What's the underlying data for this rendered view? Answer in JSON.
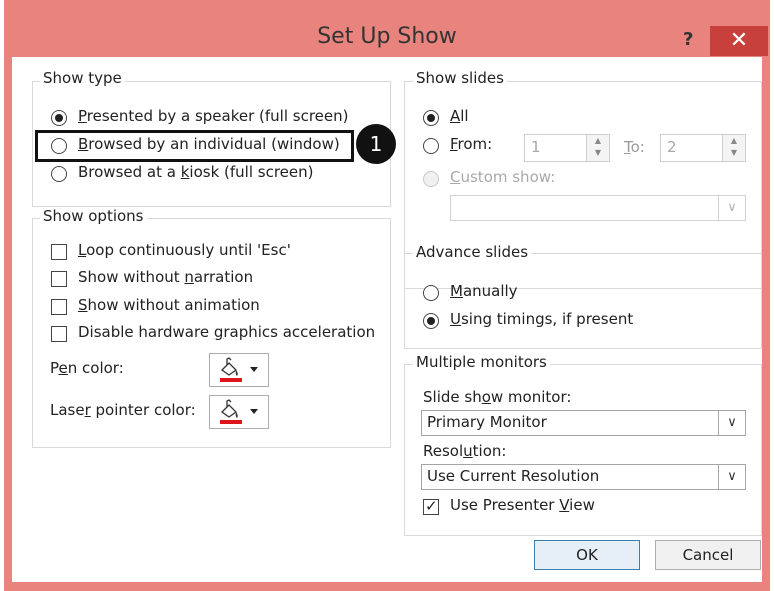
{
  "dialog": {
    "title": "Set Up Show",
    "help_glyph": "?",
    "close_glyph": "✕"
  },
  "show_type": {
    "legend": "Show type",
    "options": [
      {
        "pre": "",
        "ul": "P",
        "post": "resented by a speaker (full screen)",
        "selected": true
      },
      {
        "pre": "",
        "ul": "B",
        "post": "rowsed by an individual (window)",
        "selected": false
      },
      {
        "pre": "Browsed at a ",
        "ul": "k",
        "post": "iosk (full screen)",
        "selected": false
      }
    ]
  },
  "show_options": {
    "legend": "Show options",
    "checks": [
      {
        "pre": "",
        "ul": "L",
        "post": "oop continuously until 'Esc'",
        "checked": false
      },
      {
        "pre": "Show without ",
        "ul": "n",
        "post": "arration",
        "checked": false
      },
      {
        "pre": "",
        "ul": "S",
        "post": "how without animation",
        "checked": false
      },
      {
        "pre": "Disable hardware ",
        "ul": "g",
        "post": "raphics acceleration",
        "checked": false
      }
    ],
    "pen_color": {
      "pre": "P",
      "ul": "e",
      "post": "n color:"
    },
    "laser_color": {
      "pre": "Lase",
      "ul": "r",
      "post": " pointer color:"
    },
    "swatch_color": "#e0141e"
  },
  "show_slides": {
    "legend": "Show slides",
    "all": {
      "pre": "",
      "ul": "A",
      "post": "ll",
      "selected": true
    },
    "from": {
      "pre": "",
      "ul": "F",
      "post": "rom:",
      "selected": false,
      "value": "1"
    },
    "to": {
      "pre": "",
      "ul": "T",
      "post": "o:",
      "value": "2"
    },
    "custom": {
      "pre": "",
      "ul": "C",
      "post": "ustom show:",
      "value": ""
    }
  },
  "advance_slides": {
    "legend": "Advance slides",
    "manually": {
      "pre": "",
      "ul": "M",
      "post": "anually",
      "selected": false
    },
    "timings": {
      "pre": "",
      "ul": "U",
      "post": "sing timings, if present",
      "selected": true
    }
  },
  "monitors": {
    "legend": "Multiple monitors",
    "monitor_label": {
      "pre": "Slide sh",
      "ul": "o",
      "post": "w monitor:"
    },
    "monitor_value": "Primary Monitor",
    "resolution_label": {
      "pre": "Resol",
      "ul": "u",
      "post": "tion:"
    },
    "resolution_value": "Use Current Resolution",
    "presenter": {
      "pre": "Use Presenter ",
      "ul": "V",
      "post": "iew",
      "checked": true
    }
  },
  "buttons": {
    "ok": "OK",
    "cancel": "Cancel"
  },
  "callout": {
    "number": "1"
  },
  "colors": {
    "frame": "#e8837e",
    "close": "#c7403b",
    "default_border": "#3c7fb1"
  }
}
